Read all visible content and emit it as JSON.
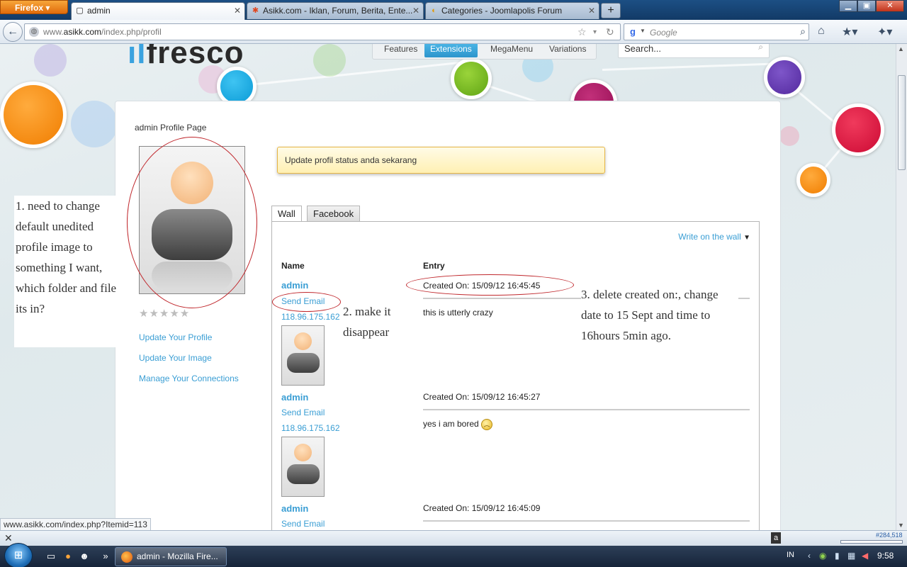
{
  "browser": {
    "menu_button": "Firefox",
    "tabs": [
      {
        "label": "admin",
        "active": true
      },
      {
        "label": "Asikk.com - Iklan, Forum, Berita, Ente...",
        "active": false
      },
      {
        "label": "Categories - Joomlapolis Forum",
        "active": false
      }
    ],
    "url_prefix": "www.",
    "url_domain": "asikk.com",
    "url_path": "/index.php/profil",
    "search_placeholder": "Google",
    "status_url": "www.asikk.com/index.php?Itemid=113"
  },
  "site": {
    "logo_text": "fresco",
    "menu": [
      {
        "label": "Features",
        "active": false
      },
      {
        "label": "Extensions",
        "active": true
      },
      {
        "label": "MegaMenu",
        "active": false
      },
      {
        "label": "Variations",
        "active": false
      }
    ],
    "search_placeholder": "Search..."
  },
  "profile": {
    "title": "admin Profile Page",
    "rating_stars": "★★★★★",
    "links": [
      "Update Your Profile",
      "Update Your Image",
      "Manage Your Connections"
    ],
    "status_prompt": "Update profil status anda sekarang",
    "tabs": [
      {
        "label": "Wall",
        "active": true
      },
      {
        "label": "Facebook",
        "active": false
      }
    ],
    "write_on_wall": "Write on the wall",
    "col_name": "Name",
    "col_entry": "Entry",
    "entries": [
      {
        "name": "admin",
        "send_email": "Send Email",
        "ip": "118.96.175.162",
        "created": "Created On: 15/09/12 16:45:45",
        "text": "this is utterly crazy",
        "emoticon": ""
      },
      {
        "name": "admin",
        "send_email": "Send Email",
        "ip": "118.96.175.162",
        "created": "Created On: 15/09/12 16:45:27",
        "text": "yes i am bored",
        "emoticon": "sad-face"
      },
      {
        "name": "admin",
        "send_email": "Send Email",
        "ip": "",
        "created": "Created On: 15/09/12 16:45:09",
        "text": "",
        "emoticon": ""
      }
    ]
  },
  "annotations": {
    "note1": "1. need to change default unedited profile image to something I want, which folder and file its in?",
    "note2": "2. make it disappear",
    "note3": "3. delete created on:, change date to 15 Sept and time to 16hours 5min ago."
  },
  "addon_bar": {
    "rank": "#284,518"
  },
  "taskbar": {
    "task_label": "admin - Mozilla Fire...",
    "language": "IN",
    "clock": "9:58"
  },
  "colors": {
    "link": "#3a9ed4",
    "menu_active": "#2d95cc",
    "annotation": "#c0282d"
  }
}
